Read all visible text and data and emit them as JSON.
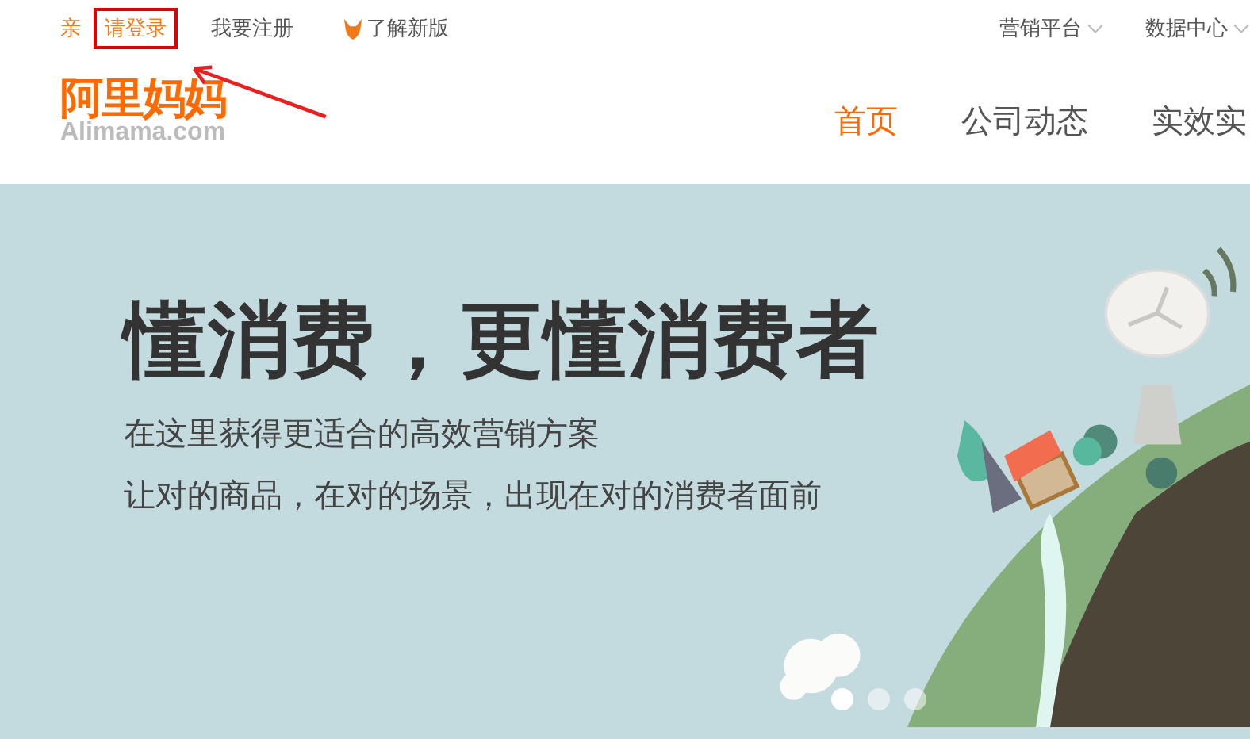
{
  "top_bar": {
    "greeting": "亲",
    "login_link": {
      "label": "请登录",
      "highlighted": true
    },
    "register_link": "我要注册",
    "new_version_link": "了解新版",
    "menus": [
      {
        "label": "营销平台"
      },
      {
        "label": "数据中心"
      }
    ]
  },
  "logo": {
    "name": "阿里妈妈",
    "domain": "Alimama.com"
  },
  "nav": [
    {
      "label": "首页",
      "selected": true
    },
    {
      "label": "公司动态",
      "selected": false
    },
    {
      "label": "实效实",
      "selected": false
    }
  ],
  "hero": {
    "title": "懂消费，更懂消费者",
    "lines": [
      "在这里获得更适合的高效营销方案",
      "让对的商品，在对的场景，出现在对的消费者面前"
    ]
  },
  "carousel": [
    {
      "selected": true
    },
    {
      "selected": false
    },
    {
      "selected": false
    }
  ]
}
